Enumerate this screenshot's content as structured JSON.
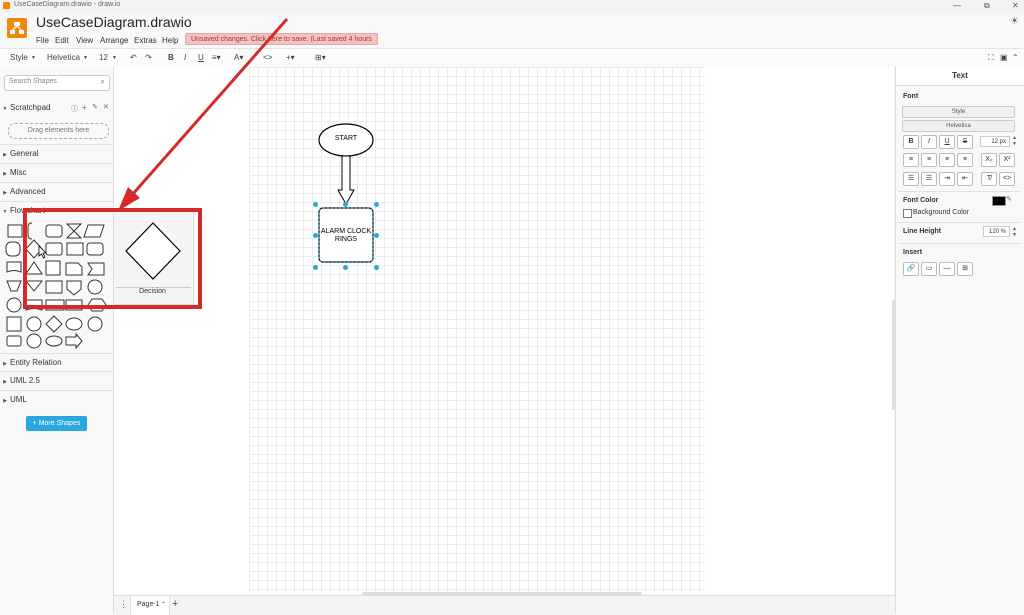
{
  "window": {
    "title": "UseCaseDiagram.drawio - draw.io",
    "doc_title": "UseCaseDiagram.drawio",
    "controls": [
      "—",
      "⧉",
      "✕"
    ]
  },
  "menu": [
    "File",
    "Edit",
    "View",
    "Arrange",
    "Extras",
    "Help"
  ],
  "unsaved_notice": "Unsaved changes. Click here to save. (Last saved 4 hours ago)",
  "toolbar": {
    "style": "Style",
    "font": "Helvetica",
    "size": "12",
    "bold": "B",
    "italic": "I",
    "underline": "U"
  },
  "left_panel": {
    "search_placeholder": "Search Shapes",
    "scratchpad": "Scratchpad",
    "drag_hint": "Drag elements here",
    "sections": [
      "General",
      "Misc",
      "Advanced",
      "Flowchart",
      "Entity Relation",
      "UML 2.5",
      "UML"
    ],
    "more_shapes": "+ More Shapes"
  },
  "popup": {
    "label": "Decision"
  },
  "diagram": {
    "start_label": "START",
    "box_label_line1": "ALARM CLOCK",
    "box_label_line2": "RINGS"
  },
  "bottom": {
    "page_tab": "Page-1",
    "add": "+"
  },
  "right_panel": {
    "tab": "Text",
    "font_label": "Font",
    "style_select": "Style",
    "font_select": "Helvetica",
    "font_size": "12 px",
    "font_color_label": "Font Color",
    "bg_color_label": "Background Color",
    "line_height_label": "Line Height",
    "line_height_value": "120 %",
    "insert_label": "Insert"
  },
  "colors": {
    "accent": "#29a8e0",
    "logo": "#f08705",
    "highlight": "#d42a2a"
  }
}
